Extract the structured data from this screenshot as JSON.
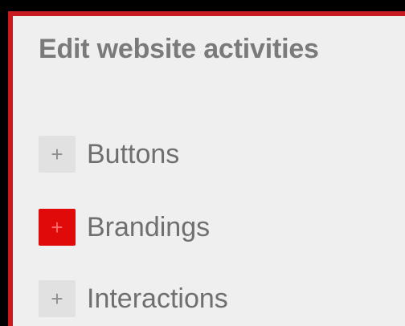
{
  "panel": {
    "title": "Edit website activities"
  },
  "items": [
    {
      "label": "Buttons",
      "icon": "plus-icon",
      "active": false
    },
    {
      "label": "Brandings",
      "icon": "plus-icon",
      "active": true
    },
    {
      "label": "Interactions",
      "icon": "plus-icon",
      "active": false
    }
  ],
  "colors": {
    "accent": "#c81b21",
    "active_button": "#e00a0a",
    "background": "#efefef"
  }
}
